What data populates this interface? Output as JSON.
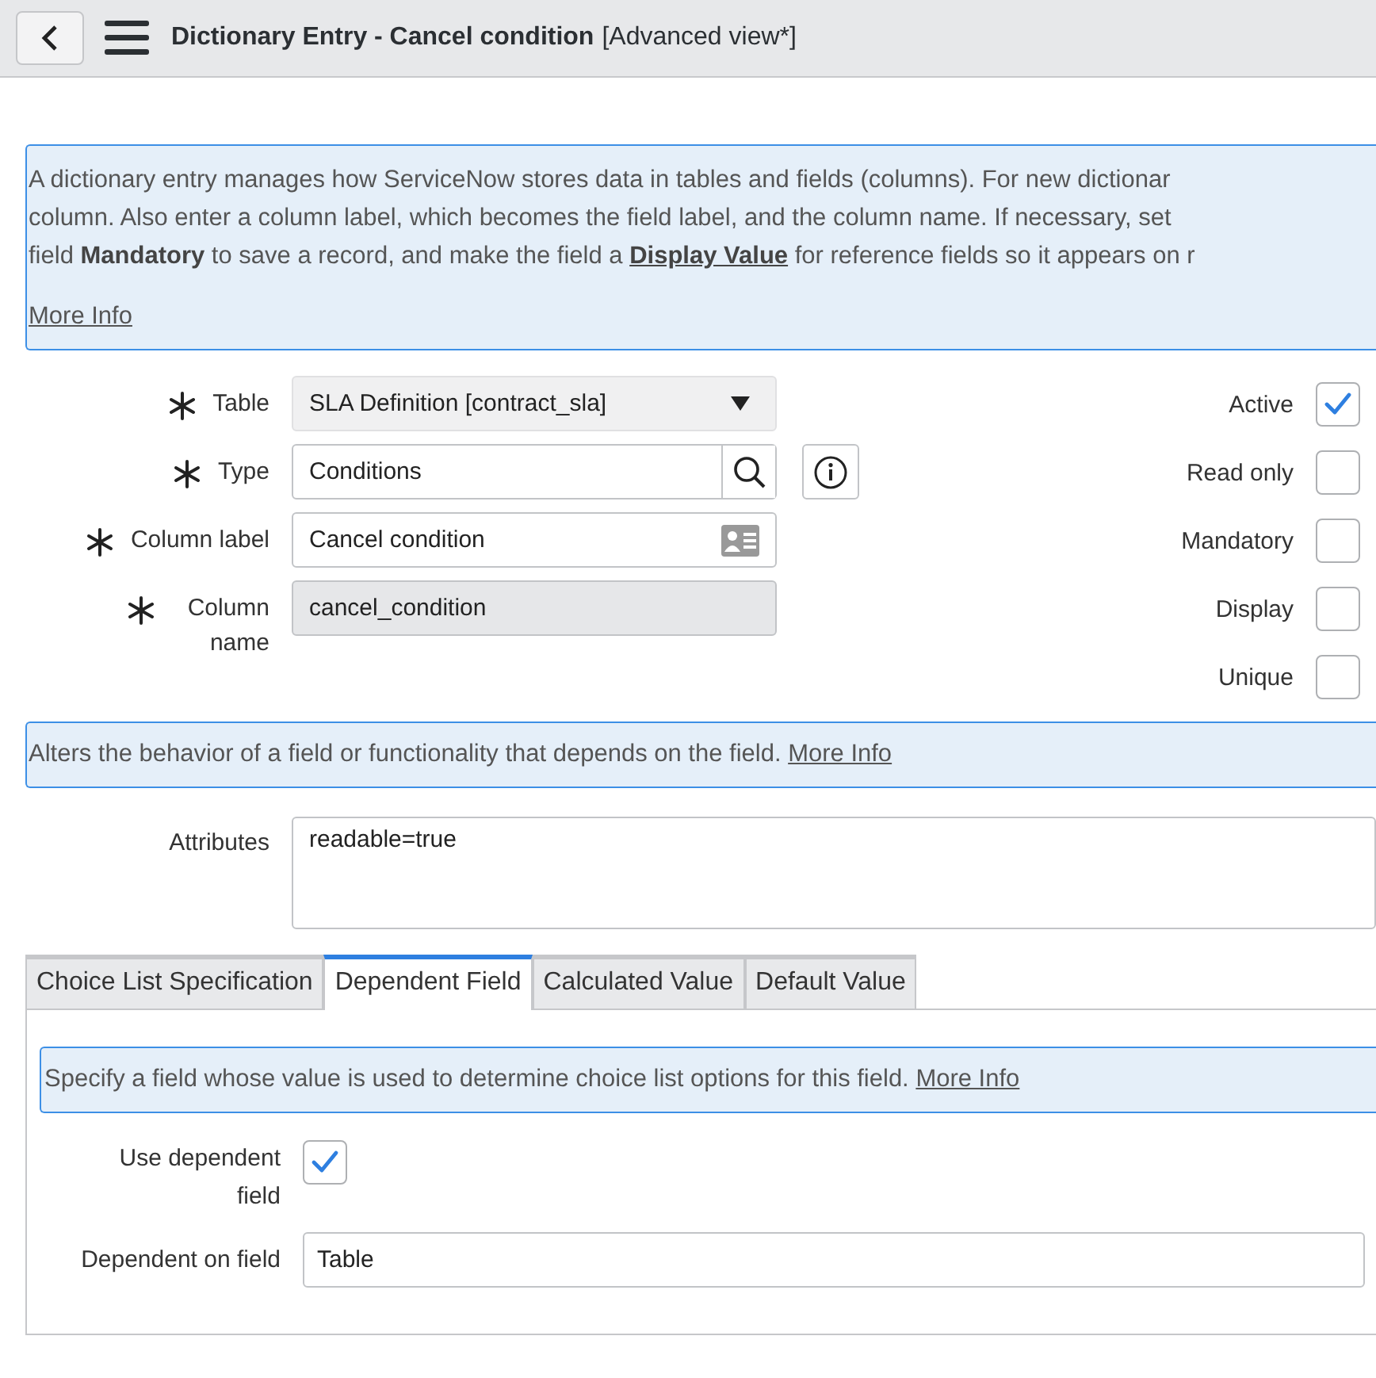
{
  "header": {
    "title": "Dictionary Entry - Cancel condition",
    "view": "[Advanced view*]"
  },
  "info": {
    "lines": [
      {
        "text": "A dictionary entry manages how ServiceNow stores data in tables and fields (columns). For new dictionar"
      },
      {
        "text": "column. Also enter a column label, which becomes the field label, and the column name. If necessary, set"
      },
      {
        "text": "field **Mandatory** to save a record, and make the field a ",
        "link": "Display Value",
        "after": " for reference fields so it appears on r"
      }
    ],
    "more": "More Info"
  },
  "fields": [
    {
      "label": "Table",
      "required": true,
      "kind": "select",
      "value": "SLA Definition [contract_sla]"
    },
    {
      "label": "Type",
      "required": true,
      "kind": "lookup",
      "value": "Conditions"
    },
    {
      "label": "Column label",
      "required": true,
      "kind": "text",
      "value": "Cancel condition"
    },
    {
      "label": "Column name",
      "required": true,
      "kind": "readonly",
      "value": "cancel_condition"
    }
  ],
  "flags": [
    {
      "label": "Active",
      "checked": true
    },
    {
      "label": "Read only",
      "checked": false
    },
    {
      "label": "Mandatory",
      "checked": false
    },
    {
      "label": "Display",
      "checked": false
    },
    {
      "label": "Unique",
      "checked": false
    }
  ],
  "attributes_info": {
    "text": "Alters the behavior of a field or functionality that depends on the field.",
    "link": "More Info"
  },
  "attributes": {
    "label": "Attributes",
    "value": "readable=true"
  },
  "tabs": [
    {
      "label": "Choice List Specification",
      "selected": false
    },
    {
      "label": "Dependent Field",
      "selected": true
    },
    {
      "label": "Calculated Value",
      "selected": false
    },
    {
      "label": "Default Value",
      "selected": false
    }
  ],
  "tab_panel": {
    "info": {
      "text": "Specify a field whose value is used to determine choice list options for this field.",
      "link": "More Info"
    },
    "use_dependent": {
      "label": "Use dependent field",
      "checked": true
    },
    "dependent_on": {
      "label": "Dependent on field",
      "value": "Table"
    }
  }
}
